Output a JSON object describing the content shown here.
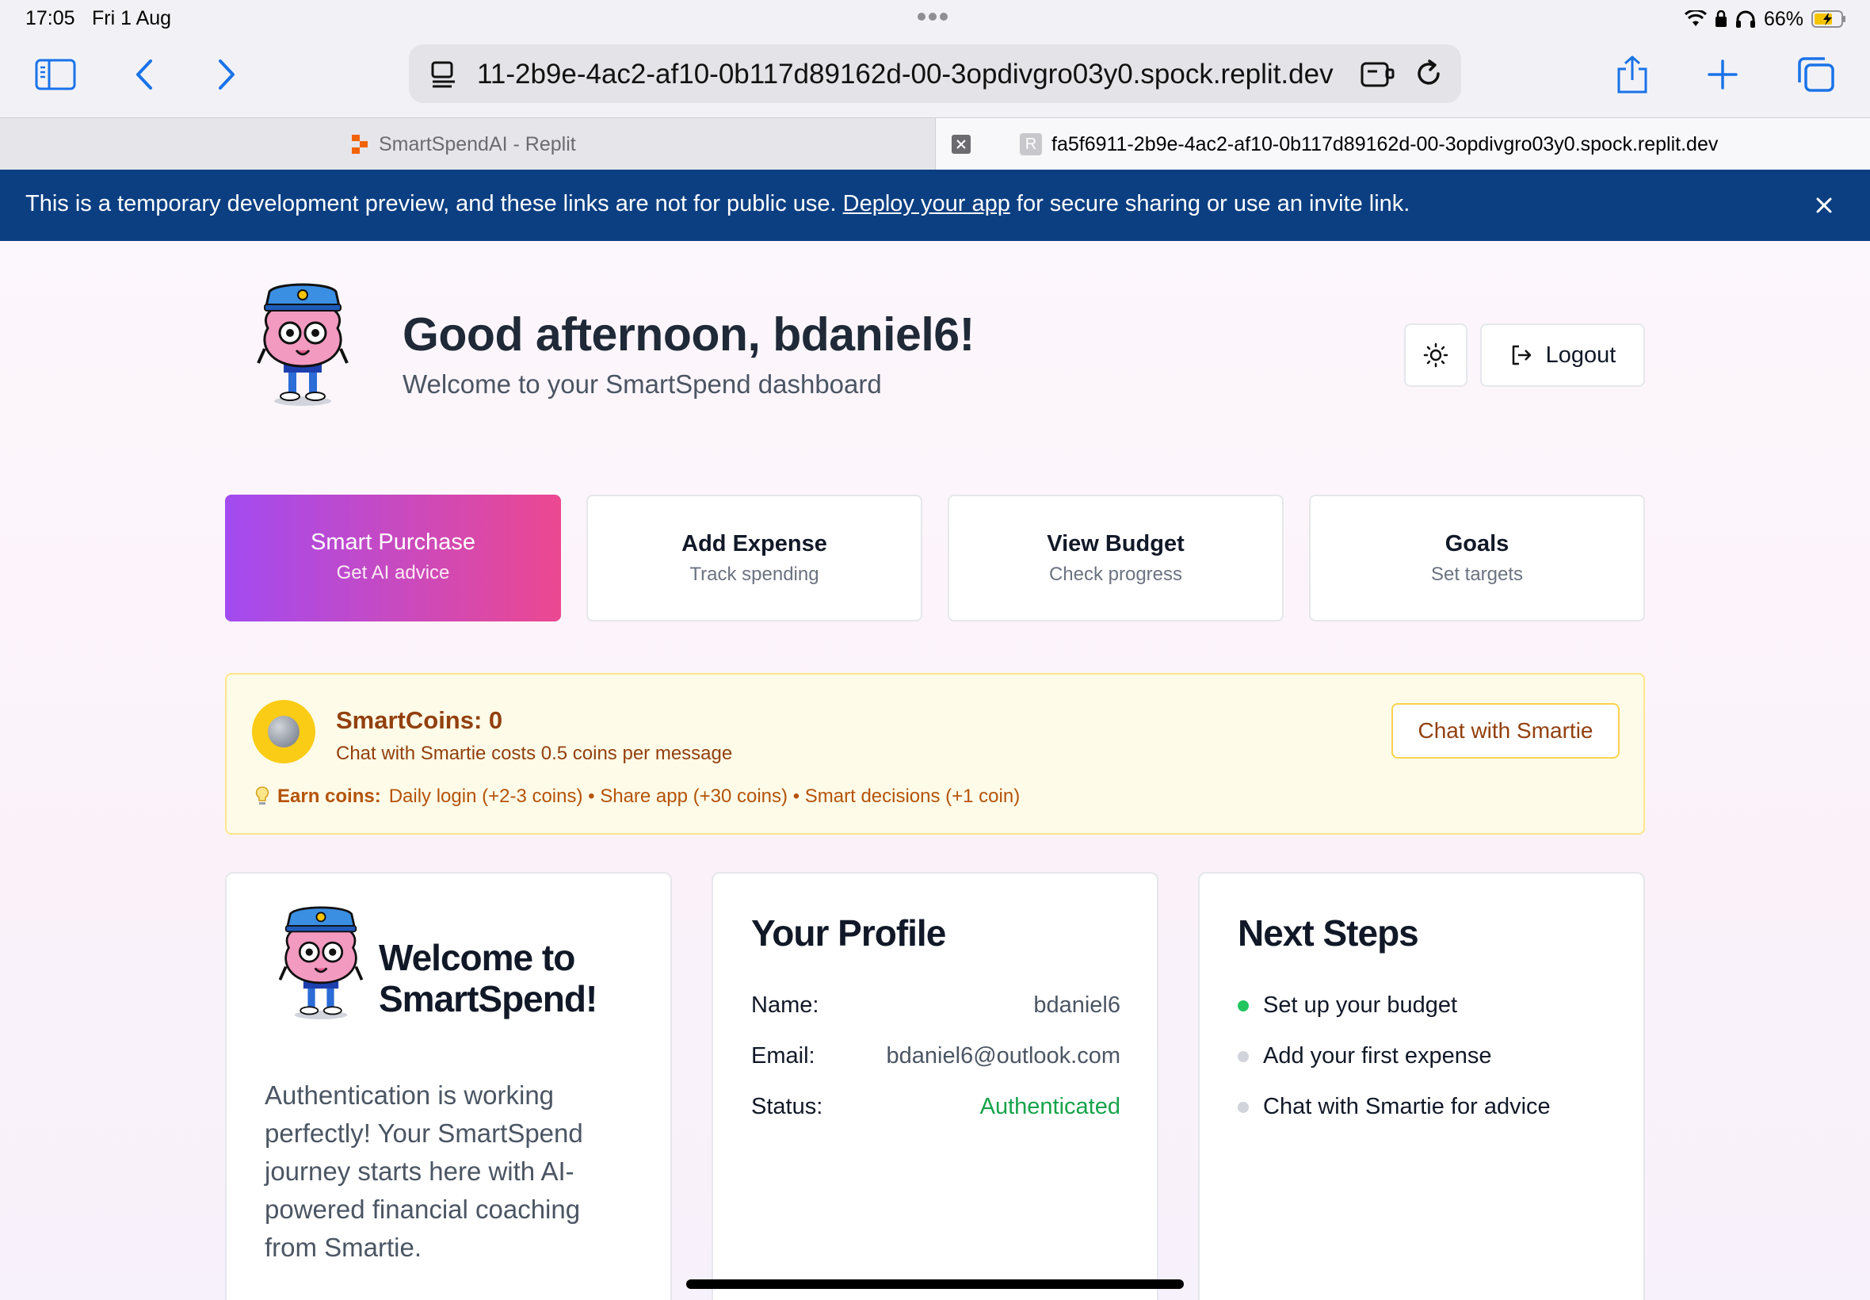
{
  "status_bar": {
    "time": "17:05",
    "date": "Fri 1 Aug",
    "battery": "66%"
  },
  "browser": {
    "url": "11-2b9e-4ac2-af10-0b117d89162d-00-3opdivgro03y0.spock.replit.dev",
    "tabs": [
      {
        "label": "SmartSpendAI - Replit"
      },
      {
        "label": "fa5f6911-2b9e-4ac2-af10-0b117d89162d-00-3opdivgro03y0.spock.replit.dev",
        "favicon": "R"
      }
    ]
  },
  "banner": {
    "text_before": "This is a temporary development preview, and these links are not for public use. ",
    "link": "Deploy your app",
    "text_after": " for secure sharing or use an invite link."
  },
  "header": {
    "greeting": "Good afternoon, bdaniel6!",
    "subtitle": "Welcome to your SmartSpend dashboard",
    "logout_label": "Logout"
  },
  "actions": [
    {
      "title": "Smart Purchase",
      "subtitle": "Get AI advice"
    },
    {
      "title": "Add Expense",
      "subtitle": "Track spending"
    },
    {
      "title": "View Budget",
      "subtitle": "Check progress"
    },
    {
      "title": "Goals",
      "subtitle": "Set targets"
    }
  ],
  "coins": {
    "title": "SmartCoins: 0",
    "subtitle": "Chat with Smartie costs 0.5 coins per message",
    "chat_button": "Chat with Smartie",
    "earn_label": "Earn coins:",
    "earn_text": "Daily login (+2-3 coins) • Share app (+30 coins) • Smart decisions (+1 coin)"
  },
  "welcome_card": {
    "title_line1": "Welcome to",
    "title_line2": "SmartSpend!",
    "body": "Authentication is working perfectly! Your SmartSpend journey starts here with AI-powered financial coaching from Smartie."
  },
  "profile_card": {
    "title": "Your Profile",
    "rows": [
      {
        "key": "Name:",
        "value": "bdaniel6"
      },
      {
        "key": "Email:",
        "value": "bdaniel6@outlook.com"
      },
      {
        "key": "Status:",
        "value": "Authenticated"
      }
    ]
  },
  "next_steps_card": {
    "title": "Next Steps",
    "steps": [
      {
        "label": "Set up your budget",
        "done": true
      },
      {
        "label": "Add your first expense",
        "done": false
      },
      {
        "label": "Chat with Smartie for advice",
        "done": false
      }
    ]
  },
  "colors": {
    "accent_from": "#a24bf1",
    "accent_to": "#ec4891",
    "banner": "#0b3f82",
    "success": "#16a34a"
  }
}
